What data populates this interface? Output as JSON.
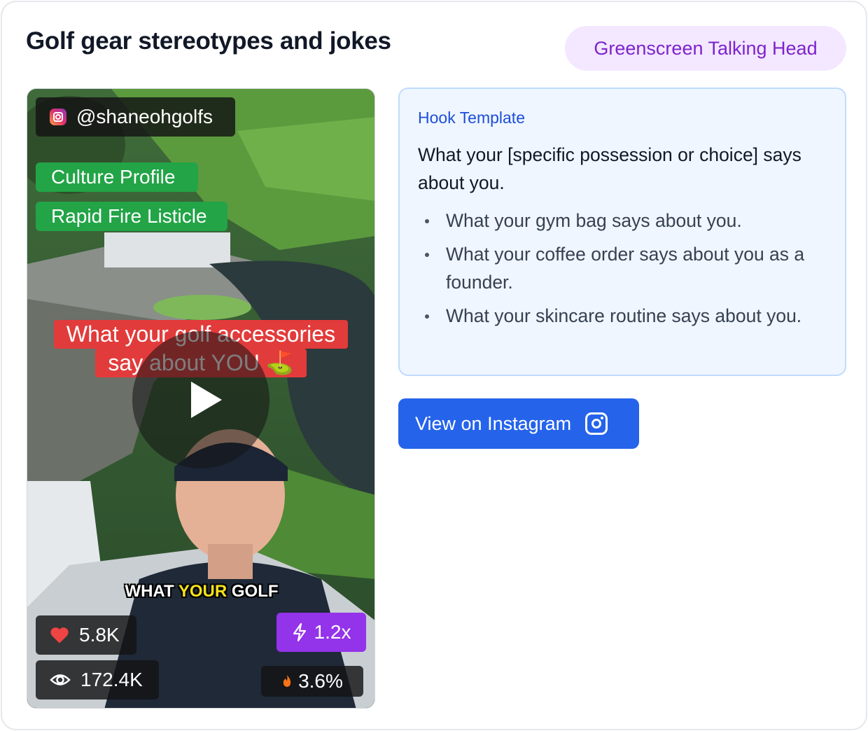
{
  "card": {
    "title": "Golf gear stereotypes and jokes",
    "category": "Greenscreen Talking Head"
  },
  "video": {
    "handle": "@shaneohgolfs",
    "tags": [
      "Culture Profile",
      "Rapid Fire Listicle"
    ],
    "headline_line1": "What your golf accessories",
    "headline_line2": "say about YOU ⛳",
    "caption_prefix": "WHAT ",
    "caption_highlight": "YOUR",
    "caption_suffix": " GOLF",
    "likes": "5.8K",
    "views": "172.4K",
    "boost": "1.2x",
    "engagement": "3.6%"
  },
  "hook": {
    "label": "Hook Template",
    "template": "What your [specific possession or choice] says about you.",
    "examples": [
      "What your gym bag says about you.",
      "What your coffee order says about you as a founder.",
      "What your skincare routine says about you."
    ]
  },
  "actions": {
    "instagram_label": "View on Instagram"
  },
  "colors": {
    "category_bg": "#f3e8ff",
    "category_text": "#7e22ce",
    "tag_green": "#22a447",
    "boost_purple": "#9333ea",
    "button_blue": "#2563eb",
    "hook_bg": "#eff6ff"
  }
}
